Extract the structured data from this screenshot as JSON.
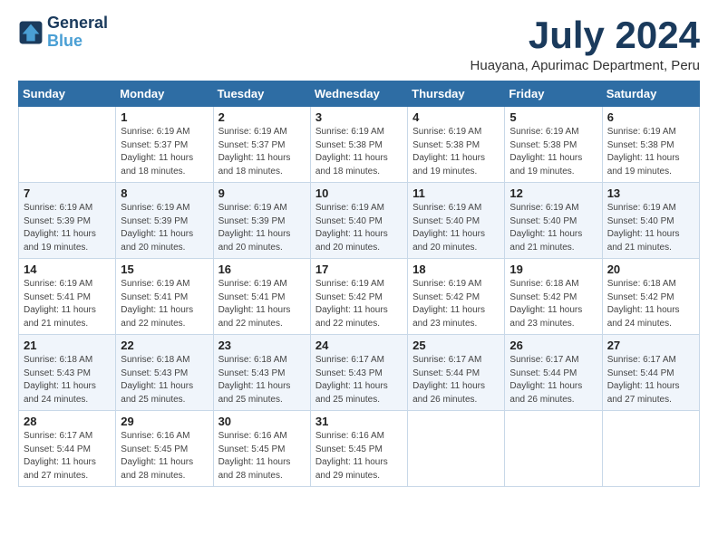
{
  "logo": {
    "line1": "General",
    "line2": "Blue"
  },
  "title": "July 2024",
  "location": "Huayana, Apurimac Department, Peru",
  "weekdays": [
    "Sunday",
    "Monday",
    "Tuesday",
    "Wednesday",
    "Thursday",
    "Friday",
    "Saturday"
  ],
  "weeks": [
    [
      {
        "day": "",
        "sunrise": "",
        "sunset": "",
        "daylight": ""
      },
      {
        "day": "1",
        "sunrise": "Sunrise: 6:19 AM",
        "sunset": "Sunset: 5:37 PM",
        "daylight": "Daylight: 11 hours and 18 minutes."
      },
      {
        "day": "2",
        "sunrise": "Sunrise: 6:19 AM",
        "sunset": "Sunset: 5:37 PM",
        "daylight": "Daylight: 11 hours and 18 minutes."
      },
      {
        "day": "3",
        "sunrise": "Sunrise: 6:19 AM",
        "sunset": "Sunset: 5:38 PM",
        "daylight": "Daylight: 11 hours and 18 minutes."
      },
      {
        "day": "4",
        "sunrise": "Sunrise: 6:19 AM",
        "sunset": "Sunset: 5:38 PM",
        "daylight": "Daylight: 11 hours and 19 minutes."
      },
      {
        "day": "5",
        "sunrise": "Sunrise: 6:19 AM",
        "sunset": "Sunset: 5:38 PM",
        "daylight": "Daylight: 11 hours and 19 minutes."
      },
      {
        "day": "6",
        "sunrise": "Sunrise: 6:19 AM",
        "sunset": "Sunset: 5:38 PM",
        "daylight": "Daylight: 11 hours and 19 minutes."
      }
    ],
    [
      {
        "day": "7",
        "sunrise": "Sunrise: 6:19 AM",
        "sunset": "Sunset: 5:39 PM",
        "daylight": "Daylight: 11 hours and 19 minutes."
      },
      {
        "day": "8",
        "sunrise": "Sunrise: 6:19 AM",
        "sunset": "Sunset: 5:39 PM",
        "daylight": "Daylight: 11 hours and 20 minutes."
      },
      {
        "day": "9",
        "sunrise": "Sunrise: 6:19 AM",
        "sunset": "Sunset: 5:39 PM",
        "daylight": "Daylight: 11 hours and 20 minutes."
      },
      {
        "day": "10",
        "sunrise": "Sunrise: 6:19 AM",
        "sunset": "Sunset: 5:40 PM",
        "daylight": "Daylight: 11 hours and 20 minutes."
      },
      {
        "day": "11",
        "sunrise": "Sunrise: 6:19 AM",
        "sunset": "Sunset: 5:40 PM",
        "daylight": "Daylight: 11 hours and 20 minutes."
      },
      {
        "day": "12",
        "sunrise": "Sunrise: 6:19 AM",
        "sunset": "Sunset: 5:40 PM",
        "daylight": "Daylight: 11 hours and 21 minutes."
      },
      {
        "day": "13",
        "sunrise": "Sunrise: 6:19 AM",
        "sunset": "Sunset: 5:40 PM",
        "daylight": "Daylight: 11 hours and 21 minutes."
      }
    ],
    [
      {
        "day": "14",
        "sunrise": "Sunrise: 6:19 AM",
        "sunset": "Sunset: 5:41 PM",
        "daylight": "Daylight: 11 hours and 21 minutes."
      },
      {
        "day": "15",
        "sunrise": "Sunrise: 6:19 AM",
        "sunset": "Sunset: 5:41 PM",
        "daylight": "Daylight: 11 hours and 22 minutes."
      },
      {
        "day": "16",
        "sunrise": "Sunrise: 6:19 AM",
        "sunset": "Sunset: 5:41 PM",
        "daylight": "Daylight: 11 hours and 22 minutes."
      },
      {
        "day": "17",
        "sunrise": "Sunrise: 6:19 AM",
        "sunset": "Sunset: 5:42 PM",
        "daylight": "Daylight: 11 hours and 22 minutes."
      },
      {
        "day": "18",
        "sunrise": "Sunrise: 6:19 AM",
        "sunset": "Sunset: 5:42 PM",
        "daylight": "Daylight: 11 hours and 23 minutes."
      },
      {
        "day": "19",
        "sunrise": "Sunrise: 6:18 AM",
        "sunset": "Sunset: 5:42 PM",
        "daylight": "Daylight: 11 hours and 23 minutes."
      },
      {
        "day": "20",
        "sunrise": "Sunrise: 6:18 AM",
        "sunset": "Sunset: 5:42 PM",
        "daylight": "Daylight: 11 hours and 24 minutes."
      }
    ],
    [
      {
        "day": "21",
        "sunrise": "Sunrise: 6:18 AM",
        "sunset": "Sunset: 5:43 PM",
        "daylight": "Daylight: 11 hours and 24 minutes."
      },
      {
        "day": "22",
        "sunrise": "Sunrise: 6:18 AM",
        "sunset": "Sunset: 5:43 PM",
        "daylight": "Daylight: 11 hours and 25 minutes."
      },
      {
        "day": "23",
        "sunrise": "Sunrise: 6:18 AM",
        "sunset": "Sunset: 5:43 PM",
        "daylight": "Daylight: 11 hours and 25 minutes."
      },
      {
        "day": "24",
        "sunrise": "Sunrise: 6:17 AM",
        "sunset": "Sunset: 5:43 PM",
        "daylight": "Daylight: 11 hours and 25 minutes."
      },
      {
        "day": "25",
        "sunrise": "Sunrise: 6:17 AM",
        "sunset": "Sunset: 5:44 PM",
        "daylight": "Daylight: 11 hours and 26 minutes."
      },
      {
        "day": "26",
        "sunrise": "Sunrise: 6:17 AM",
        "sunset": "Sunset: 5:44 PM",
        "daylight": "Daylight: 11 hours and 26 minutes."
      },
      {
        "day": "27",
        "sunrise": "Sunrise: 6:17 AM",
        "sunset": "Sunset: 5:44 PM",
        "daylight": "Daylight: 11 hours and 27 minutes."
      }
    ],
    [
      {
        "day": "28",
        "sunrise": "Sunrise: 6:17 AM",
        "sunset": "Sunset: 5:44 PM",
        "daylight": "Daylight: 11 hours and 27 minutes."
      },
      {
        "day": "29",
        "sunrise": "Sunrise: 6:16 AM",
        "sunset": "Sunset: 5:45 PM",
        "daylight": "Daylight: 11 hours and 28 minutes."
      },
      {
        "day": "30",
        "sunrise": "Sunrise: 6:16 AM",
        "sunset": "Sunset: 5:45 PM",
        "daylight": "Daylight: 11 hours and 28 minutes."
      },
      {
        "day": "31",
        "sunrise": "Sunrise: 6:16 AM",
        "sunset": "Sunset: 5:45 PM",
        "daylight": "Daylight: 11 hours and 29 minutes."
      },
      {
        "day": "",
        "sunrise": "",
        "sunset": "",
        "daylight": ""
      },
      {
        "day": "",
        "sunrise": "",
        "sunset": "",
        "daylight": ""
      },
      {
        "day": "",
        "sunrise": "",
        "sunset": "",
        "daylight": ""
      }
    ]
  ]
}
